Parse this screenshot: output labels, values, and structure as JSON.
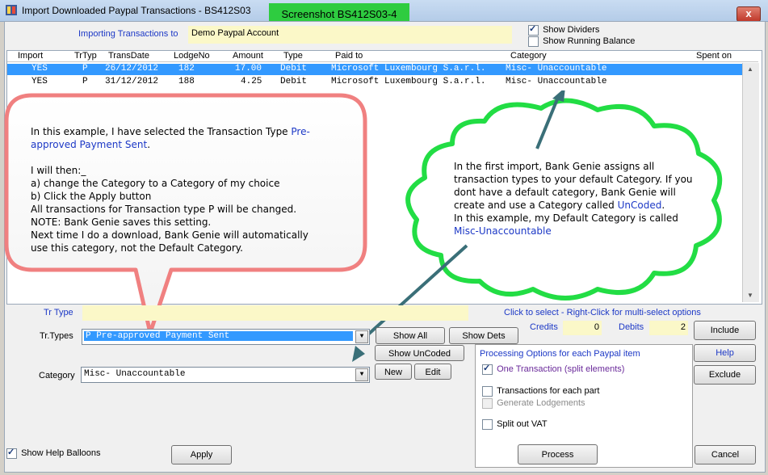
{
  "window": {
    "title": "Import Downloaded Paypal Transactions - BS412S03",
    "close_label": "x"
  },
  "overlay_label": "Screenshot BS412S03-4",
  "importing": {
    "label": "Importing Transactions to",
    "value": "Demo Paypal Account"
  },
  "options": {
    "show_dividers": "Show Dividers",
    "show_running_balance": "Show Running Balance"
  },
  "table": {
    "headers": [
      "Import",
      "TrTyp",
      "TransDate",
      "LodgeNo",
      "Amount",
      "Type",
      "Paid to",
      "Category",
      "Spent on"
    ],
    "rows": [
      [
        "YES",
        "P",
        "26/12/2012",
        "182",
        "17.00",
        "Debit",
        "Microsoft Luxembourg S.a.r.l.",
        "Misc- Unaccountable"
      ],
      [
        "YES",
        "P",
        "31/12/2012",
        "188",
        "4.25",
        "Debit",
        "Microsoft Luxembourg S.a.r.l.",
        "Misc- Unaccountable"
      ]
    ]
  },
  "callout_left": {
    "line1": "In this example, I have selected the Transaction Type ",
    "line1_highlight": "Pre-",
    "line2_highlight": "approved Payment Sent",
    "line2": ".",
    "line3": "I will then:_",
    "line4": "a) change the Category to a Category of my choice",
    "line5": "b) Click the Apply button",
    "line6": "All transactions for Transaction type P will be changed.",
    "line7": "NOTE: Bank Genie saves this setting.",
    "line8": "Next time I do a download, Bank Genie will automatically",
    "line9": "use this category, not the Default Category."
  },
  "callout_right": {
    "line1": "In the first import, Bank Genie assigns all",
    "line2": "transaction types to your default Category. If you",
    "line3": "dont have a default category, Bank Genie will",
    "line4": "create and use a Category called ",
    "line4_highlight": "UnCoded",
    "line4_end": ".",
    "line5": "In this example, my Default Category is called",
    "line6_highlight": "Misc-Unaccountable"
  },
  "trtype": {
    "label": "Tr Type",
    "value": ""
  },
  "hint": "Click to select   - Right-Click for multi-select options",
  "credits": {
    "label": "Credits",
    "value": "0"
  },
  "debits": {
    "label": "Debits",
    "value": "2"
  },
  "trtypes": {
    "label": "Tr.Types",
    "value": "P Pre-approved Payment Sent"
  },
  "category": {
    "label": "Category",
    "value": "Misc- Unaccountable"
  },
  "buttons": {
    "show_all": "Show All",
    "show_dets": "Show Dets",
    "show_uncoded": "Show UnCoded",
    "new": "New",
    "edit": "Edit",
    "include": "Include",
    "help": "Help",
    "exclude": "Exclude",
    "apply": "Apply",
    "process": "Process",
    "cancel": "Cancel"
  },
  "processing": {
    "title": "Processing Options for each Paypal  item",
    "one_transaction": "One Transaction (split elements)",
    "each_part": "Transactions for each part",
    "generate_lodgements": "Generate Lodgements",
    "split_vat": "Split out VAT"
  },
  "show_help_balloons": "Show Help Balloons"
}
